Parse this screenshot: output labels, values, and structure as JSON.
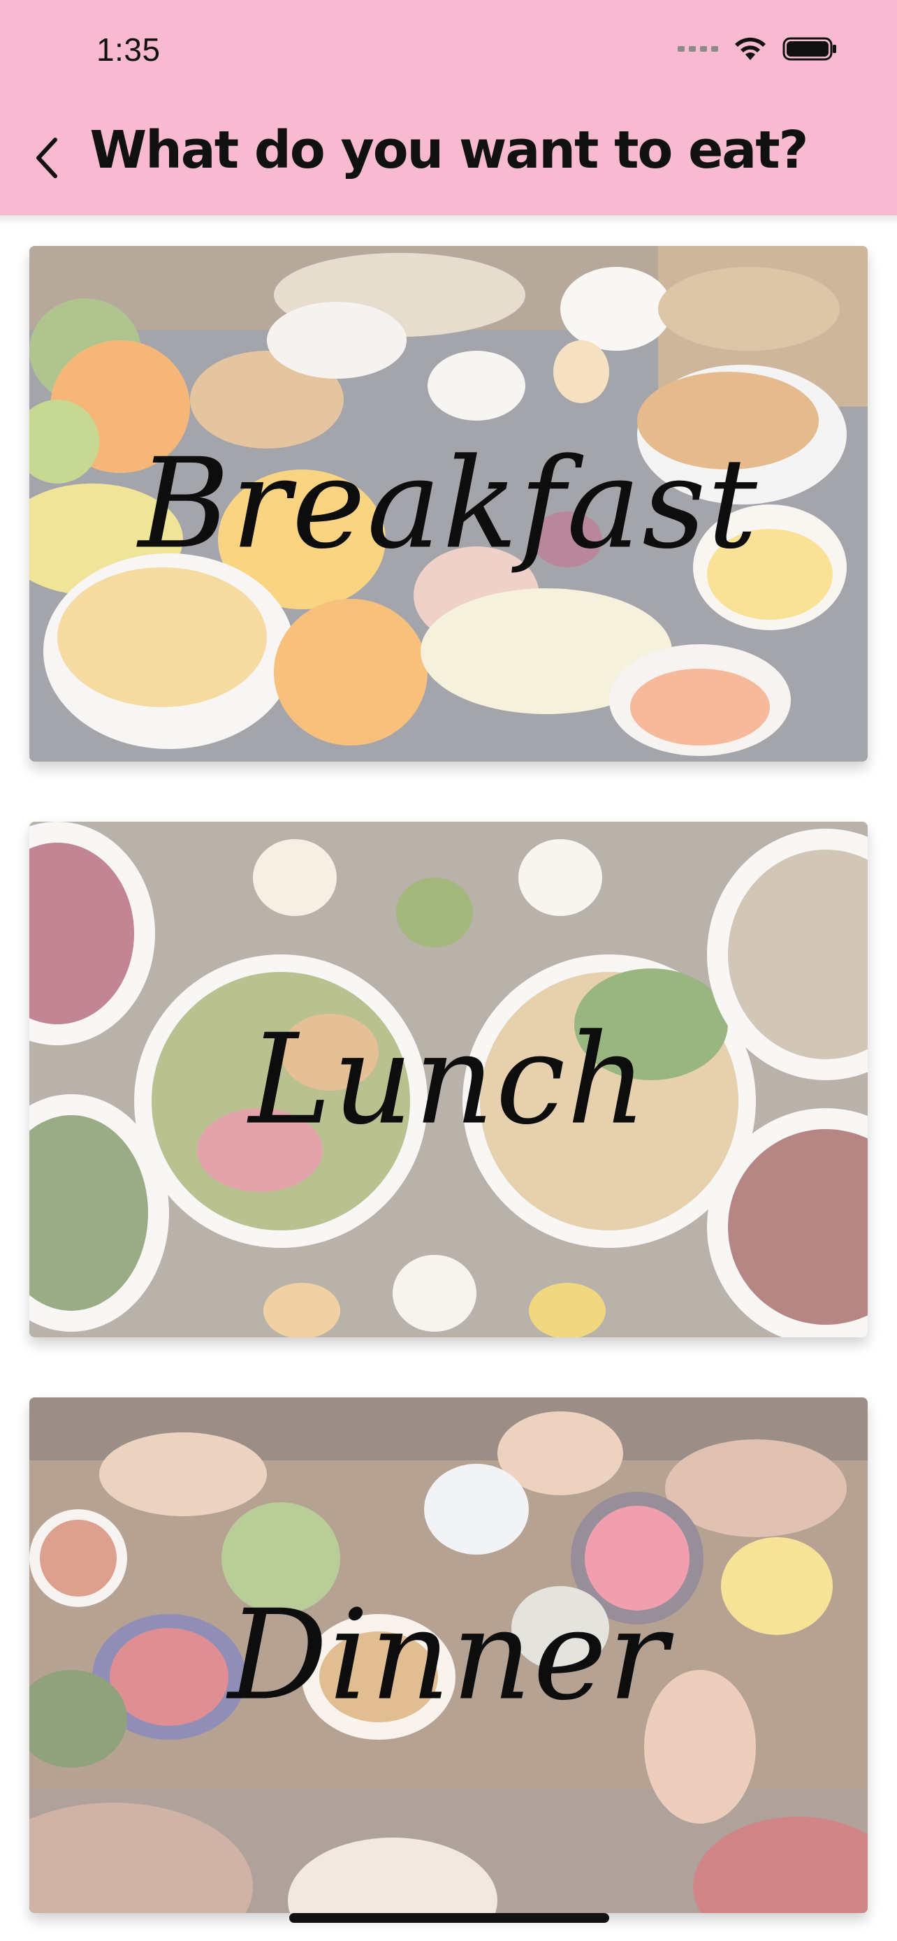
{
  "status_bar": {
    "time": "1:35"
  },
  "header": {
    "title": "What do you want to eat?",
    "back_icon": "chevron-left-icon",
    "background": "#f8bad0"
  },
  "meals": [
    {
      "label": "Breakfast"
    },
    {
      "label": "Lunch"
    },
    {
      "label": "Dinner"
    }
  ]
}
